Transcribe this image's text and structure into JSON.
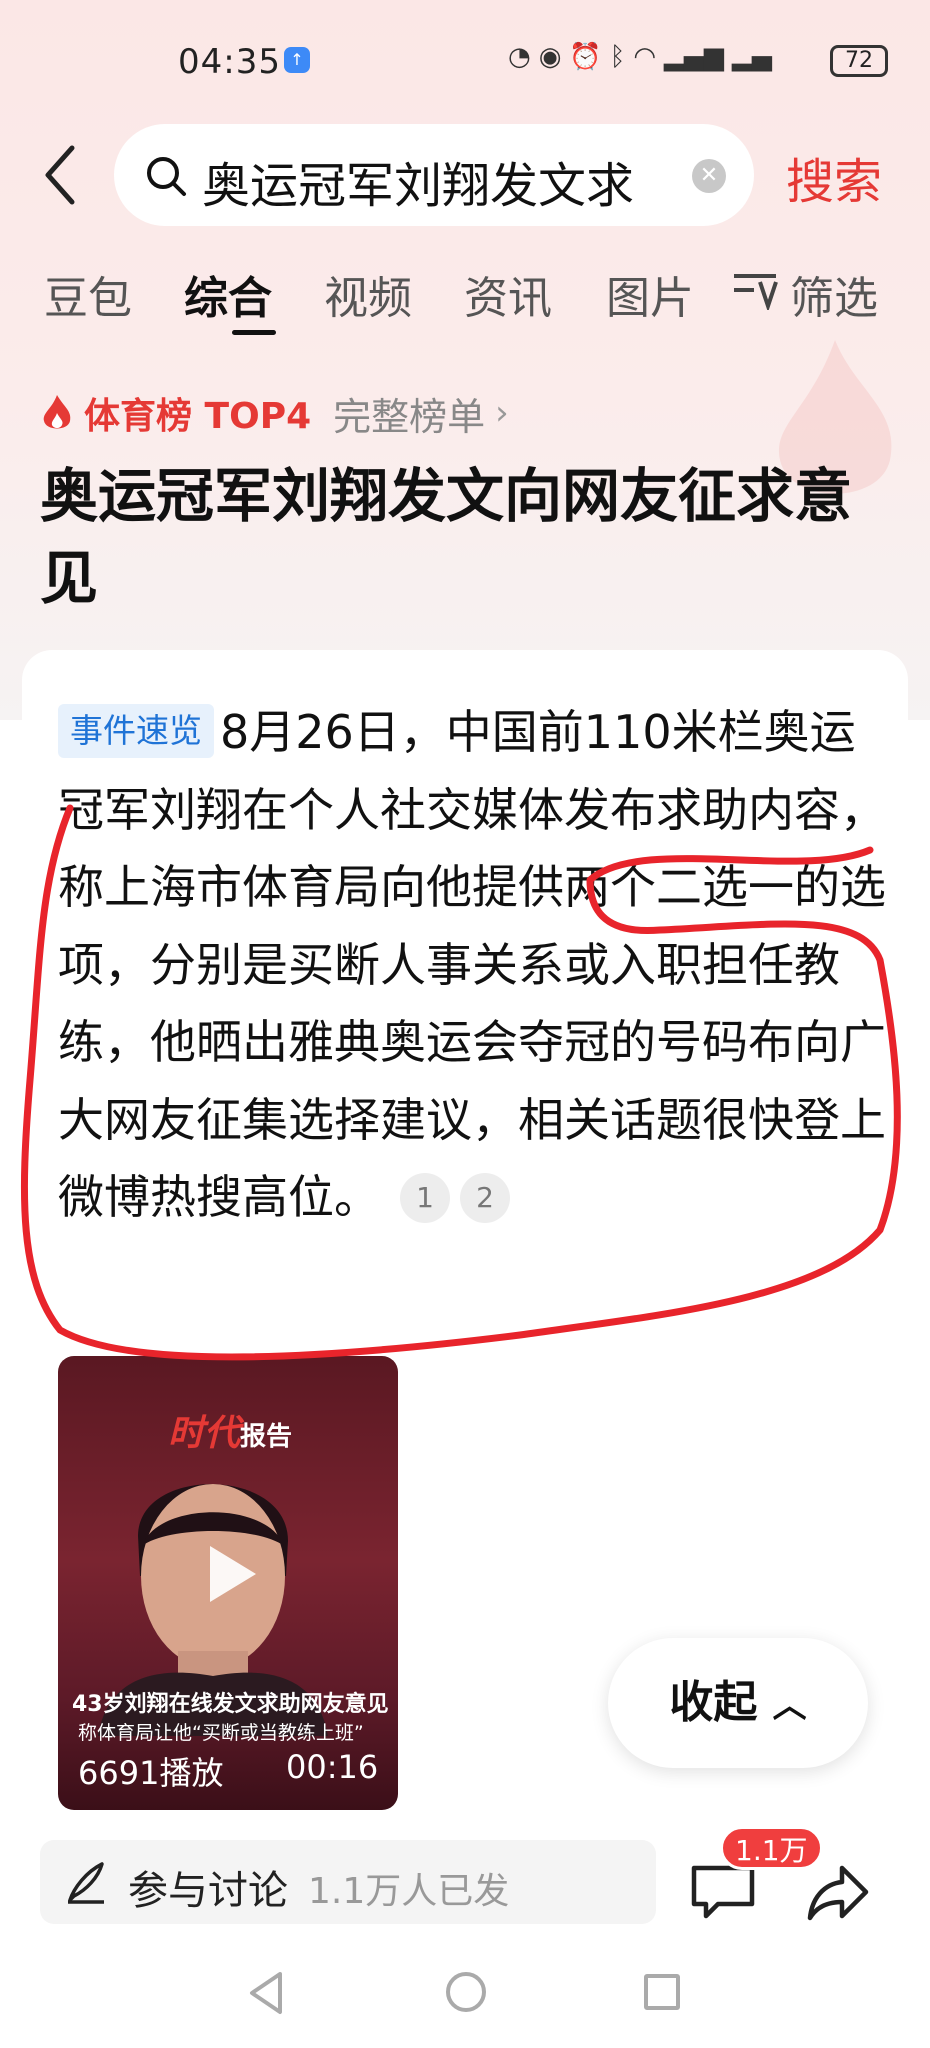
{
  "status_bar": {
    "time": "04:35",
    "battery": "72"
  },
  "search": {
    "query": "奥运冠军刘翔发文求",
    "button_label": "搜索"
  },
  "tabs": [
    {
      "label": "豆包"
    },
    {
      "label": "综合"
    },
    {
      "label": "视频"
    },
    {
      "label": "资讯"
    },
    {
      "label": "图片"
    },
    {
      "label": "筛选"
    }
  ],
  "rank": {
    "label": "体育榜 TOP4",
    "full_list": "完整榜单"
  },
  "headline": "奥运冠军刘翔发文向网友征求意见",
  "summary": {
    "tag": "事件速览",
    "text": "8月26日，中国前110米栏奥运冠军刘翔在个人社交媒体发布求助内容，称上海市体育局向他提供两个二选一的选项，分别是买断人事关系或入职担任教练，他晒出雅典奥运会夺冠的号码布向广大网友征集选择建议，相关话题很快登上微博热搜高位。",
    "citations": [
      "1",
      "2"
    ]
  },
  "video": {
    "logo_main": "时代",
    "logo_sub": "报告",
    "caption_line1": "43岁刘翔在线发文求助网友意见",
    "caption_line2": "称体育局让他“买断或当教练上班”",
    "plays": "6691播放",
    "duration": "00:16"
  },
  "collapse": {
    "label": "收起"
  },
  "bottom": {
    "discuss_label": "参与讨论",
    "discuss_count": "1.1万人已发",
    "comment_badge": "1.1万"
  },
  "colors": {
    "accent_red": "#e53935",
    "tag_blue": "#1f73d6",
    "annotation_red": "#e8242b"
  },
  "icons": [
    "back-arrow-icon",
    "search-icon",
    "clear-icon",
    "filter-icon",
    "flame-icon",
    "play-icon",
    "chevron-up-icon",
    "pen-icon",
    "comment-icon",
    "share-icon"
  ]
}
